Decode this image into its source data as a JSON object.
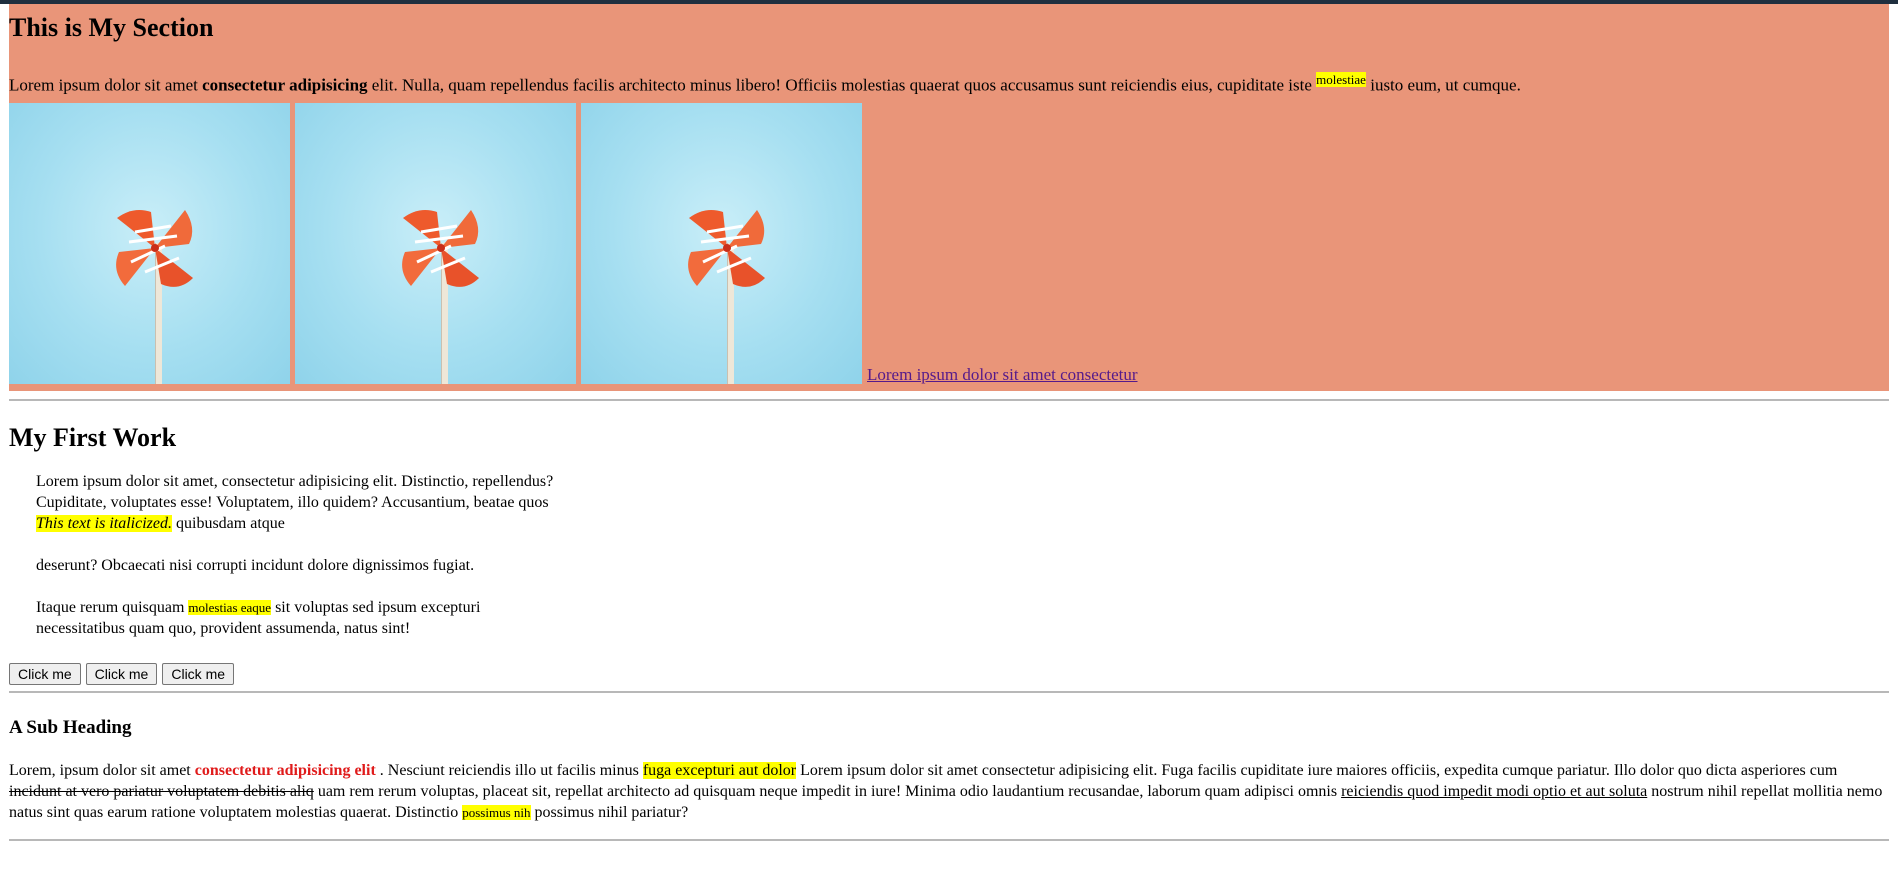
{
  "hero": {
    "title": "This is My Section",
    "para": {
      "t1": "Lorem ipsum dolor sit amet ",
      "bold": "consectetur adipisicing",
      "t2": " elit. Nulla, quam repellendus facilis architecto minus libero! Officiis molestias quaerat quos accusamus sunt reiciendis eius, cupiditate iste ",
      "mark": "molestiae",
      "t3": " iusto eum, ut cumque."
    },
    "link": "Lorem ipsum dolor sit amet consectetur"
  },
  "work": {
    "title": "My First Work",
    "p1": {
      "t1": "Lorem ipsum dolor sit amet, consectetur adipisicing elit. Distinctio, repellendus? Cupiditate, voluptates esse! Voluptatem, illo quidem? Accusantium, beatae quos ",
      "italic": "This text is italicized.",
      "t2": " quibusdam atque"
    },
    "p2": "deserunt? Obcaecati nisi corrupti incidunt dolore dignissimos fugiat.",
    "p3": {
      "t1": "Itaque rerum quisquam ",
      "mark": "molestias eaque",
      "t2": " sit voluptas sed ipsum excepturi necessitatibus quam quo, provident assumenda, natus sint!"
    },
    "buttons": [
      "Click me",
      "Click me",
      "Click me"
    ]
  },
  "sub": {
    "title": "A Sub Heading",
    "t1": "Lorem, ipsum dolor sit amet ",
    "red": "consectetur adipisicing elit",
    "t2": " . Nesciunt reiciendis illo ut facilis minus ",
    "mark": "fuga excepturi aut dolor",
    "t3": " Lorem ipsum dolor sit amet consectetur adipisicing elit. Fuga facilis cupiditate iure maiores officiis, expedita cumque pariatur. Illo dolor quo dicta asperiores cum ",
    "strike": "incidunt at vero pariatur voluptatem debitis aliq",
    "t4": " uam rem rerum voluptas, placeat sit, repellat architecto ad quisquam neque impedit in iure! Minima odio laudantium recusandae, laborum quam adipisci omnis ",
    "underline": "reiciendis quod impedit modi optio et aut soluta",
    "t5": " nostrum nihil repellat mollitia nemo natus sint quas earum ratione voluptatem molestias quaerat. Distinctio ",
    "mark2": "possimus nih",
    "t6": " possimus nihil pariatur?"
  },
  "colors": {
    "section_bg": "#e99579",
    "highlight": "#ffff00",
    "red_text": "#e01b1b",
    "link": "#551a8b"
  },
  "icons": [
    "pinwheel-image"
  ]
}
